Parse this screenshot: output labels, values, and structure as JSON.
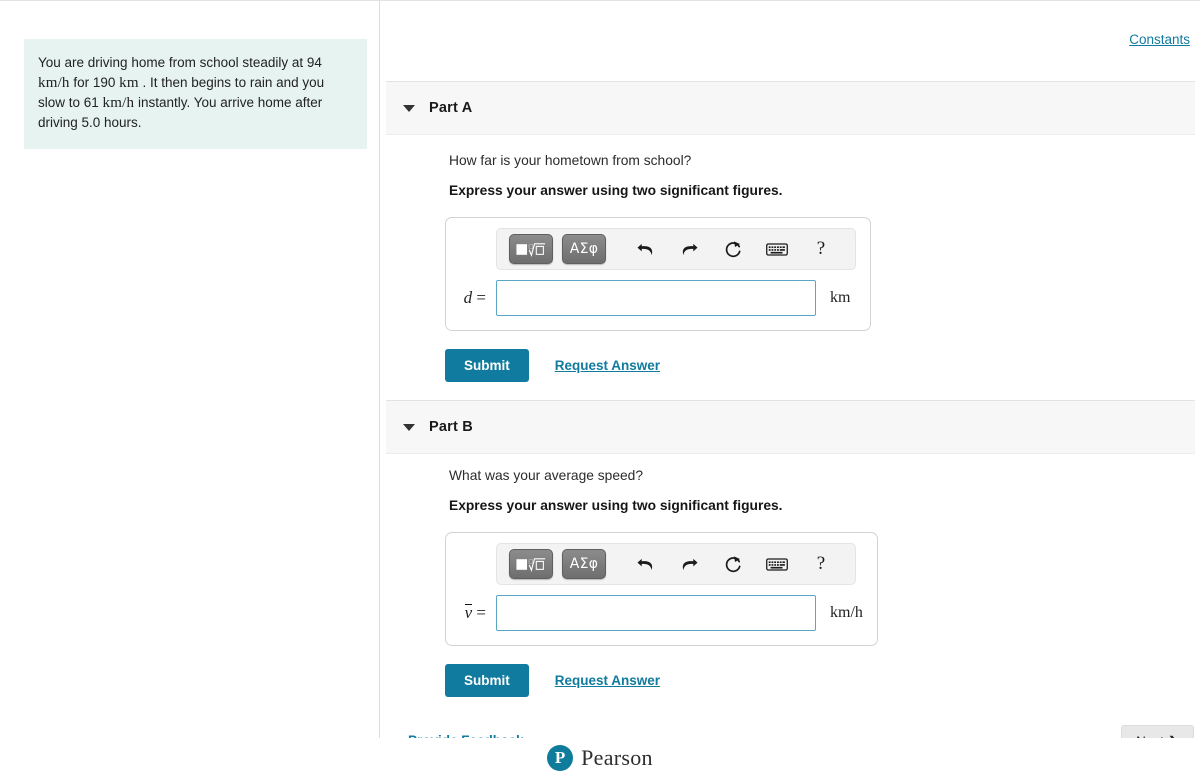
{
  "problem": {
    "text_parts": [
      {
        "t": "You are driving home from school steadily at 94 ",
        "math": false
      },
      {
        "t": "km/h",
        "math": true
      },
      {
        "t": " for 190 ",
        "math": false
      },
      {
        "t": "km",
        "math": true
      },
      {
        "t": " . It then begins to rain and you slow to 61 ",
        "math": false
      },
      {
        "t": "km/h",
        "math": true
      },
      {
        "t": " instantly. You arrive home after driving 5.0 hours.",
        "math": false
      }
    ],
    "full_text": "You are driving home from school steadily at 94 km/h for 190 km . It then begins to rain and you slow to 61 km/h instantly. You arrive home after driving 5.0 hours."
  },
  "header": {
    "constants_label": "Constants"
  },
  "toolbar": {
    "template_button_label": "▢√",
    "greek_button_label": "ΑΣφ",
    "undo_icon": "undo-icon",
    "redo_icon": "redo-icon",
    "reset_icon": "reset-icon",
    "keyboard_icon": "keyboard-icon",
    "help_label": "?"
  },
  "parts": [
    {
      "id": "A",
      "title": "Part A",
      "question": "How far is your hometown from school?",
      "instruction": "Express your answer using two significant figures.",
      "variable": "d",
      "variable_overbar": false,
      "equals": "=",
      "value": "",
      "unit": "km",
      "submit_label": "Submit",
      "request_answer_label": "Request Answer"
    },
    {
      "id": "B",
      "title": "Part B",
      "question": "What was your average speed?",
      "instruction": "Express your answer using two significant figures.",
      "variable": "v",
      "variable_overbar": true,
      "equals": "=",
      "value": "",
      "unit": "km/h",
      "submit_label": "Submit",
      "request_answer_label": "Request Answer"
    }
  ],
  "footer": {
    "provide_feedback_label": "Provide Feedback",
    "next_label": "Next ❯",
    "brand_mark": "P",
    "brand_name": "Pearson"
  },
  "colors": {
    "accent_teal": "#107b9e",
    "problem_bg": "#e6f3f1",
    "part_header_bg": "#f7f7f7",
    "input_border": "#5aa7c4"
  }
}
